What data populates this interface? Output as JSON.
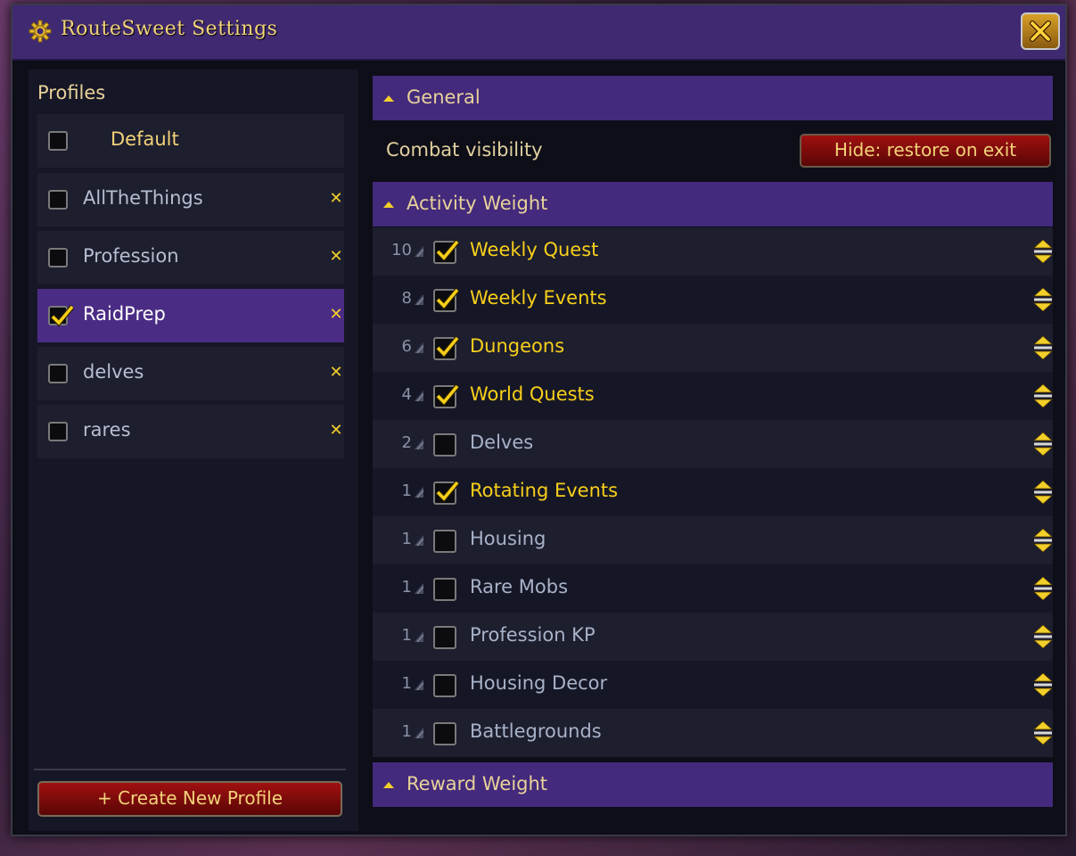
{
  "window": {
    "title": "RouteSweet Settings"
  },
  "profiles": {
    "heading": "Profiles",
    "items": [
      {
        "label": "Default",
        "checked": false,
        "active": false,
        "deletable": false
      },
      {
        "label": "AllTheThings",
        "checked": false,
        "active": false,
        "deletable": true
      },
      {
        "label": "Profession",
        "checked": false,
        "active": false,
        "deletable": true
      },
      {
        "label": "RaidPrep",
        "checked": true,
        "active": true,
        "deletable": true
      },
      {
        "label": "delves",
        "checked": false,
        "active": false,
        "deletable": true
      },
      {
        "label": "rares",
        "checked": false,
        "active": false,
        "deletable": true
      }
    ],
    "create_button": "+ Create New Profile"
  },
  "general": {
    "heading": "General",
    "combat_visibility_label": "Combat visibility",
    "combat_visibility_value": "Hide: restore on exit"
  },
  "activity_weight": {
    "heading": "Activity Weight",
    "items": [
      {
        "weight": "10",
        "label": "Weekly Quest",
        "checked": true
      },
      {
        "weight": "8",
        "label": "Weekly Events",
        "checked": true
      },
      {
        "weight": "6",
        "label": "Dungeons",
        "checked": true
      },
      {
        "weight": "4",
        "label": "World Quests",
        "checked": true
      },
      {
        "weight": "2",
        "label": "Delves",
        "checked": false
      },
      {
        "weight": "1",
        "label": "Rotating Events",
        "checked": true
      },
      {
        "weight": "1",
        "label": "Housing",
        "checked": false
      },
      {
        "weight": "1",
        "label": "Rare Mobs",
        "checked": false
      },
      {
        "weight": "1",
        "label": "Profession KP",
        "checked": false
      },
      {
        "weight": "1",
        "label": "Housing Decor",
        "checked": false
      },
      {
        "weight": "1",
        "label": "Battlegrounds",
        "checked": false
      }
    ]
  },
  "reward_weight": {
    "heading": "Reward Weight"
  },
  "colors": {
    "accent_gold": "#f7cf1a",
    "header_purple": "#432a7c",
    "button_red": "#a01010"
  }
}
